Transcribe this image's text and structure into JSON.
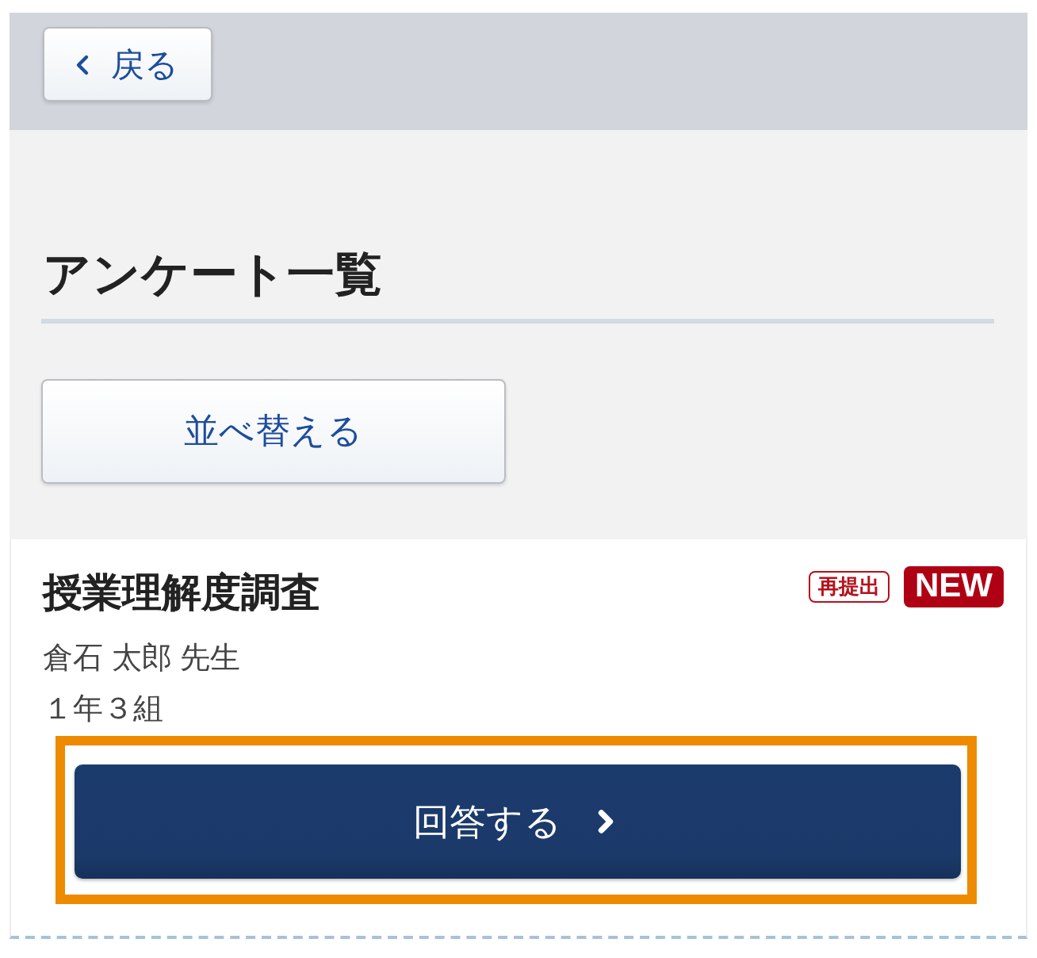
{
  "header": {
    "back_button": {
      "label": "戻る"
    }
  },
  "page_title": "アンケート一覧",
  "sort_button": {
    "label": "並べ替える"
  },
  "surveys": [
    {
      "title": "授業理解度調査",
      "badges": [
        {
          "kind": "outline",
          "label": "再提出"
        },
        {
          "kind": "filled",
          "label": "NEW"
        }
      ],
      "teacher": "倉石 太郎 先生",
      "class": "１年３組",
      "answer_button": {
        "label": "回答する",
        "highlighted": true
      }
    }
  ]
}
